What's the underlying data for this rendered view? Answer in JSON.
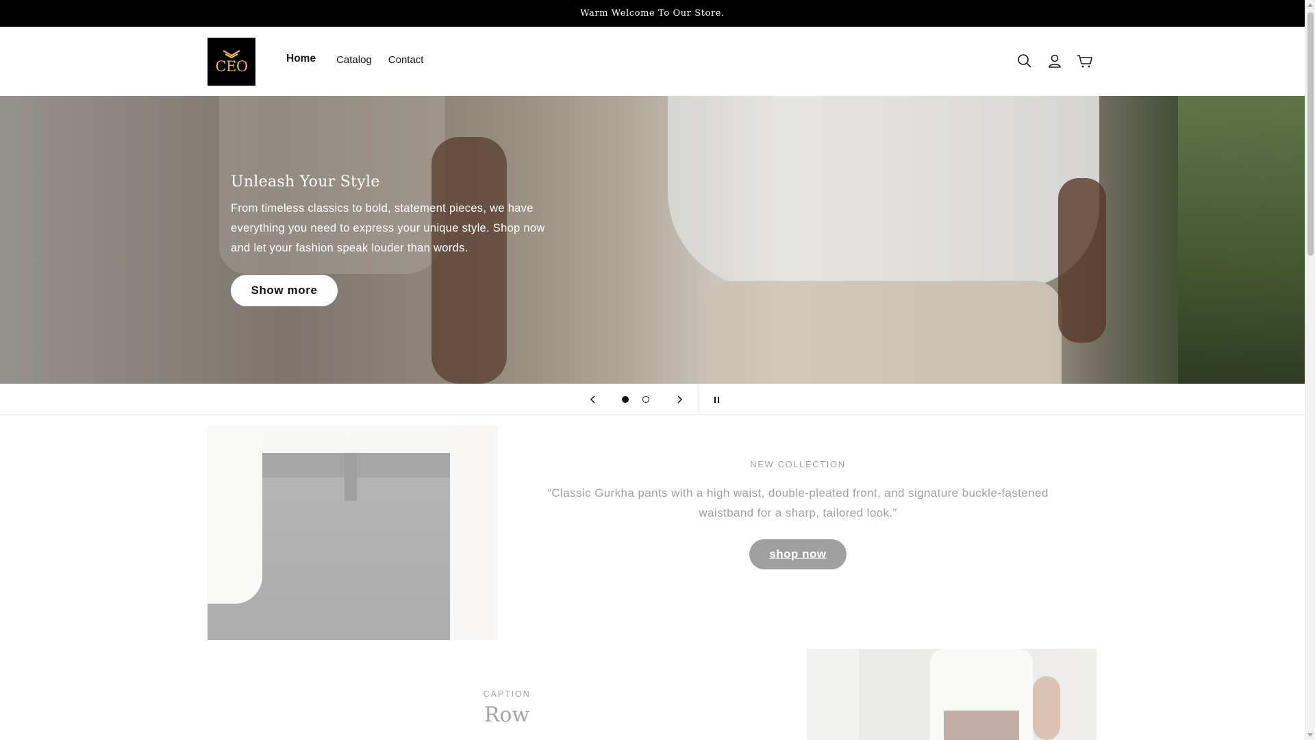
{
  "announcement": {
    "text": "Warm Welcome To Our Store."
  },
  "header": {
    "logo_text": "CEO",
    "nav": [
      {
        "label": "Home",
        "active": true
      },
      {
        "label": "Catalog",
        "active": false
      },
      {
        "label": "Contact",
        "active": false
      }
    ],
    "icons": [
      "search-icon",
      "account-icon",
      "cart-icon"
    ]
  },
  "hero": {
    "title": "Unleash Your Style",
    "text": "From timeless classics to bold, statement pieces, we have everything you need to express your unique style. Shop now and let your fashion speak louder than words.",
    "button_label": "Show more"
  },
  "slider": {
    "slide_count": 2,
    "current_slide": 1
  },
  "feature": {
    "eyebrow": "NEW COLLECTION",
    "text": "“Classic Gurkha pants with a high waist, double-pleated front, and signature buckle-fastened waistband for a sharp, tailored look.”",
    "button_label": "shop now"
  },
  "row": {
    "caption": "CAPTION",
    "title": "Row"
  },
  "colors": {
    "accent": "#121212",
    "announcement_bg": "#000000",
    "logo_gold": "#e3b94a"
  }
}
